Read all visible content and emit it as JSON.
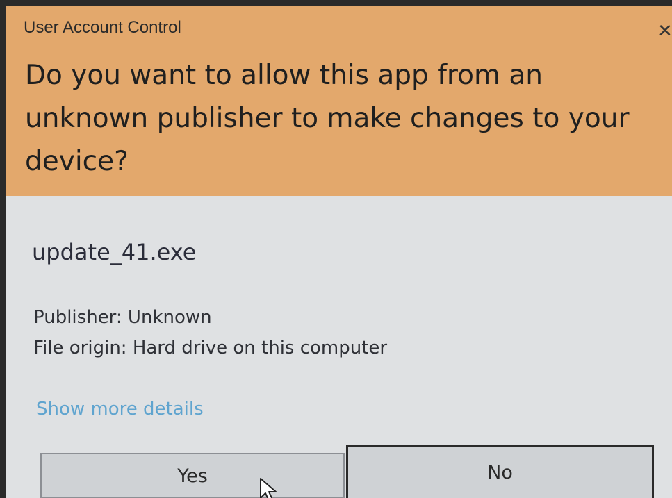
{
  "window": {
    "title": "User Account Control",
    "close_icon": "close-icon"
  },
  "header": {
    "question": "Do you want to allow this app from an unknown publisher to make changes to your device?",
    "background_color": "#e3a86c"
  },
  "details": {
    "app_name": "update_41.exe",
    "publisher": "Publisher: Unknown",
    "file_origin": "File origin: Hard drive on this computer",
    "show_more_label": "Show more details",
    "link_color": "#5fa4cf"
  },
  "buttons": {
    "yes_label": "Yes",
    "no_label": "No"
  },
  "pointer": {
    "icon": "mouse-pointer-icon"
  }
}
